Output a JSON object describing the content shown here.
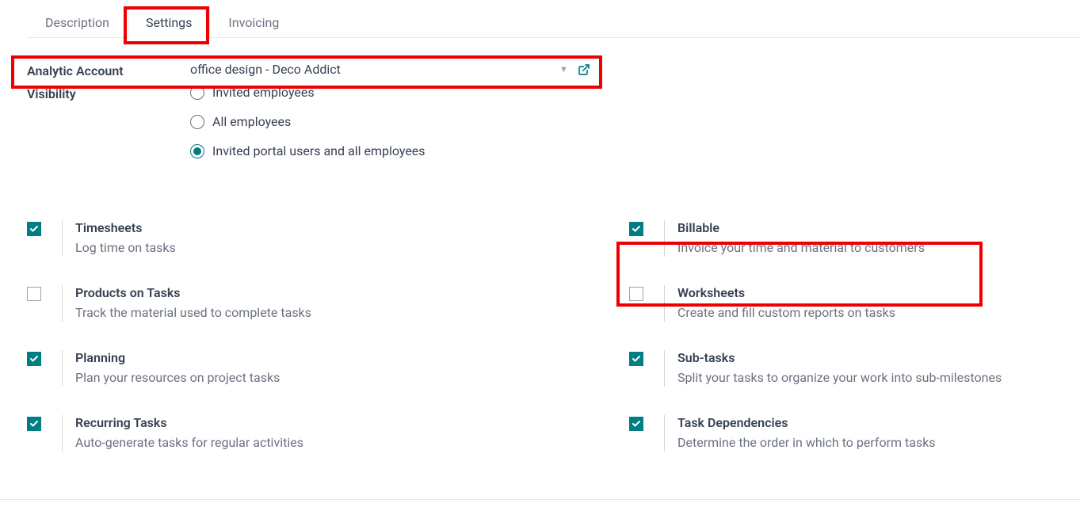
{
  "tabs": [
    {
      "label": "Description",
      "active": false
    },
    {
      "label": "Settings",
      "active": true
    },
    {
      "label": "Invoicing",
      "active": false
    }
  ],
  "form": {
    "analytic_account": {
      "label": "Analytic Account",
      "value": "office design - Deco Addict"
    },
    "visibility": {
      "label": "Visibility",
      "options": [
        {
          "label": "Invited employees",
          "checked": false
        },
        {
          "label": "All employees",
          "checked": false
        },
        {
          "label": "Invited portal users and all employees",
          "checked": true
        }
      ]
    }
  },
  "settings_left": [
    {
      "title": "Timesheets",
      "desc": "Log time on tasks",
      "checked": true
    },
    {
      "title": "Products on Tasks",
      "desc": "Track the material used to complete tasks",
      "checked": false
    },
    {
      "title": "Planning",
      "desc": "Plan your resources on project tasks",
      "checked": true
    },
    {
      "title": "Recurring Tasks",
      "desc": "Auto-generate tasks for regular activities",
      "checked": true
    }
  ],
  "settings_right": [
    {
      "title": "Billable",
      "desc": "Invoice your time and material to customers",
      "checked": true
    },
    {
      "title": "Worksheets",
      "desc": "Create and fill custom reports on tasks",
      "checked": false
    },
    {
      "title": "Sub-tasks",
      "desc": "Split your tasks to organize your work into sub-milestones",
      "checked": true
    },
    {
      "title": "Task Dependencies",
      "desc": "Determine the order in which to perform tasks",
      "checked": true
    }
  ]
}
